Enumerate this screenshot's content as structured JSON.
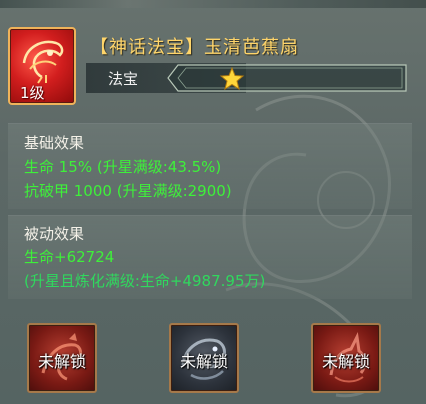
{
  "header": {
    "title": "【神话法宝】玉清芭蕉扇",
    "level": "1级",
    "type_label": "法宝",
    "star_count": 1,
    "icon": "fan-artifact-icon",
    "title_color": "#ffd56a",
    "icon_bg_color": "#d21e1e"
  },
  "basic_effects": {
    "heading": "基础效果",
    "lines": [
      "生命 15% (升星满级:43.5%)",
      "抗破甲 1000 (升星满级:2900)"
    ]
  },
  "passive_effects": {
    "heading": "被动效果",
    "lines": [
      "生命+62724",
      "(升星且炼化满级:生命+4987.95万)"
    ]
  },
  "slots": [
    {
      "label": "未解锁",
      "icon": "red-beast-icon"
    },
    {
      "label": "未解锁",
      "icon": "dark-dragon-icon"
    },
    {
      "label": "未解锁",
      "icon": "red-fox-icon"
    }
  ],
  "colors": {
    "effect_text": "#3ef03a",
    "heading_text": "#f4f1e8"
  }
}
